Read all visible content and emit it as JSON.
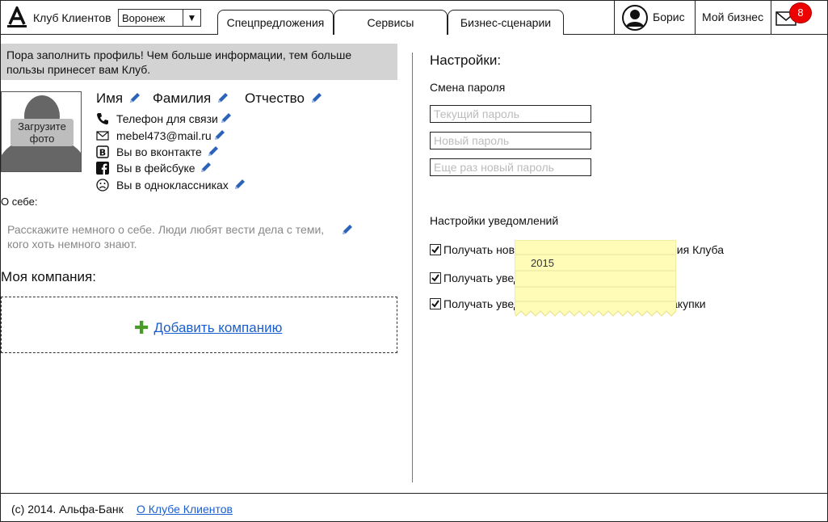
{
  "header": {
    "club_title": "Клуб Клиентов",
    "city": "Воронеж",
    "tabs": [
      {
        "label": "Спецпредложения"
      },
      {
        "label": "Сервисы"
      },
      {
        "label": "Бизнес-сценарии"
      }
    ],
    "user_name": "Борис",
    "my_business": "Мой бизнес",
    "mail_count": "8"
  },
  "profile": {
    "notice": "Пора заполнить профиль! Чем больше информации, тем больше пользы принесет вам Клуб.",
    "photo_button": "Загрузите фото",
    "first_name": "Имя",
    "last_name": "Фамилия",
    "middle_name": "Отчество",
    "contacts": {
      "phone": "Телефон для связи",
      "email": "mebel473@mail.ru",
      "vk": "Вы во вконтакте",
      "facebook": "Вы в фейсбуке",
      "ok": "Вы в одноклассниках"
    },
    "about_label": "О себе:",
    "about_placeholder": "Расскажите немного о себе. Люди любят вести дела с теми, кого хоть немного знают."
  },
  "company": {
    "title": "Моя компания:",
    "add_label": "Добавить компанию"
  },
  "settings": {
    "title": "Настройки:",
    "password_label": "Смена пароля",
    "current_password_placeholder": "Текущий пароль",
    "new_password_placeholder": "Новый пароль",
    "repeat_password_placeholder": "Еще раз новый пароль",
    "notifications_label": "Настройки уведомлений",
    "notifications": [
      {
        "label": "Получать нов",
        "suffix": "ния Клуба",
        "checked": true
      },
      {
        "label": "Получать увед",
        "suffix": "",
        "checked": true
      },
      {
        "label": "Получать увед",
        "suffix": "акупки",
        "checked": true
      }
    ],
    "sticky_note": "2015"
  },
  "footer": {
    "copyright": "(c) 2014. Альфа-Банк",
    "about_link": "О Клубе Клиентов"
  },
  "colors": {
    "accent_link": "#1a5fd0",
    "badge": "#e00000",
    "notice_bg": "#d3d3d3",
    "sticky_bg": "#fffcb8",
    "add_plus": "#4a9a2a"
  }
}
